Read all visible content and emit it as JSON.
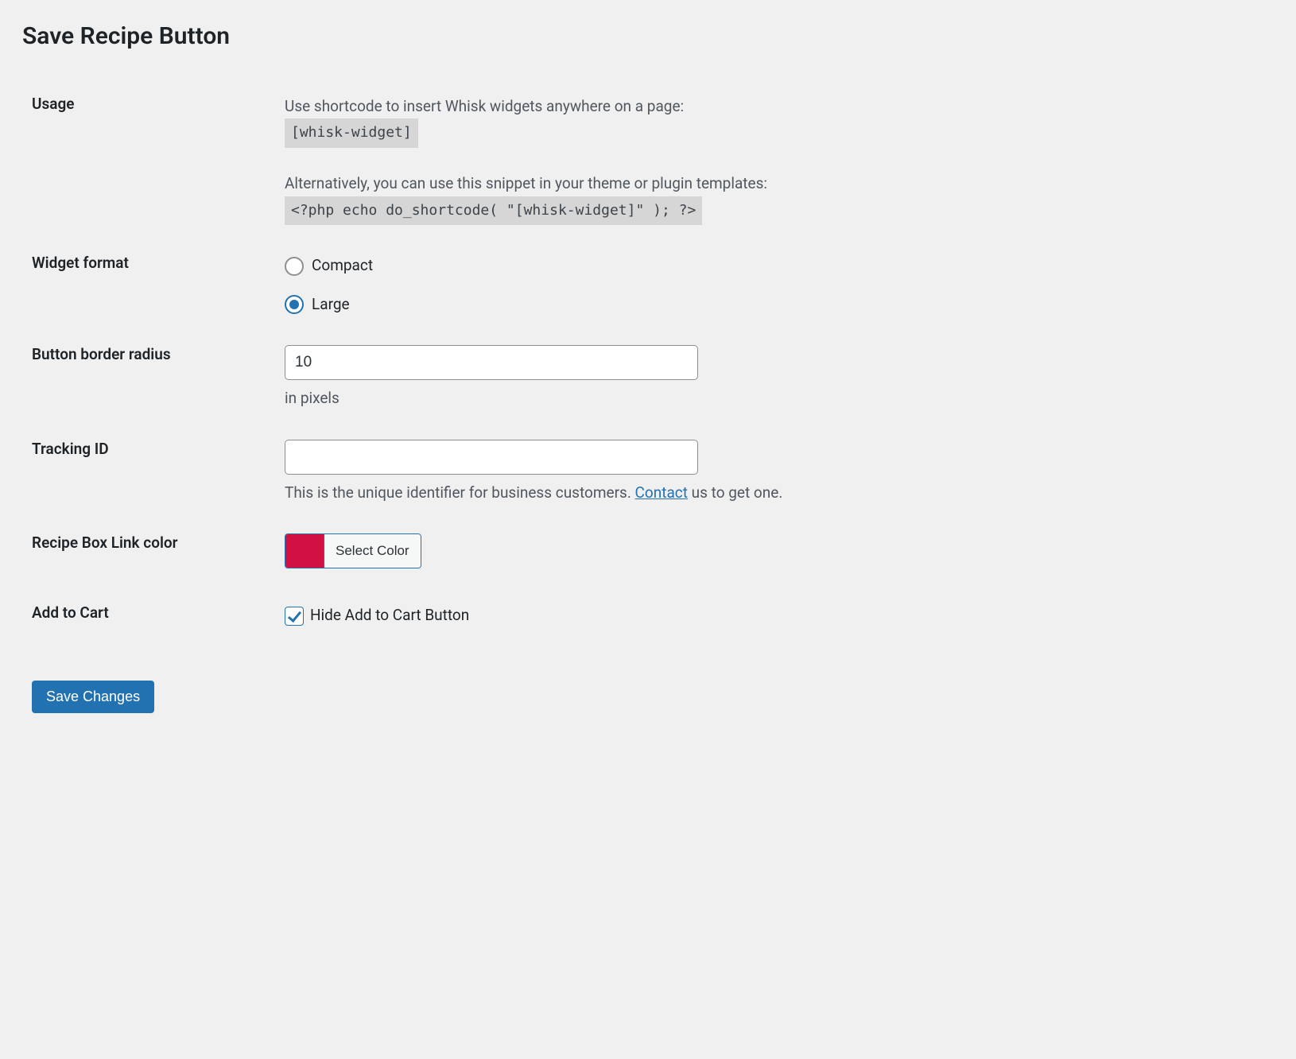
{
  "section": {
    "title": "Save Recipe Button"
  },
  "usage": {
    "label": "Usage",
    "intro": "Use shortcode to insert Whisk widgets anywhere on a page:",
    "shortcode": "[whisk-widget]",
    "alt_intro": "Alternatively, you can use this snippet in your theme or plugin templates:",
    "php_snippet": "<?php echo do_shortcode( \"[whisk-widget]\" ); ?>"
  },
  "widget_format": {
    "label": "Widget format",
    "options": {
      "compact": "Compact",
      "large": "Large"
    },
    "selected": "large"
  },
  "border_radius": {
    "label": "Button border radius",
    "value": "10",
    "help": "in pixels"
  },
  "tracking_id": {
    "label": "Tracking ID",
    "value": "",
    "help_pre": "This is the unique identifier for business customers. ",
    "help_link": "Contact",
    "help_post": " us to get one."
  },
  "link_color": {
    "label": "Recipe Box Link color",
    "swatch": "#d11043",
    "button": "Select Color"
  },
  "add_to_cart": {
    "label": "Add to Cart",
    "checkbox_label": "Hide Add to Cart Button",
    "checked": true
  },
  "submit": {
    "label": "Save Changes"
  }
}
